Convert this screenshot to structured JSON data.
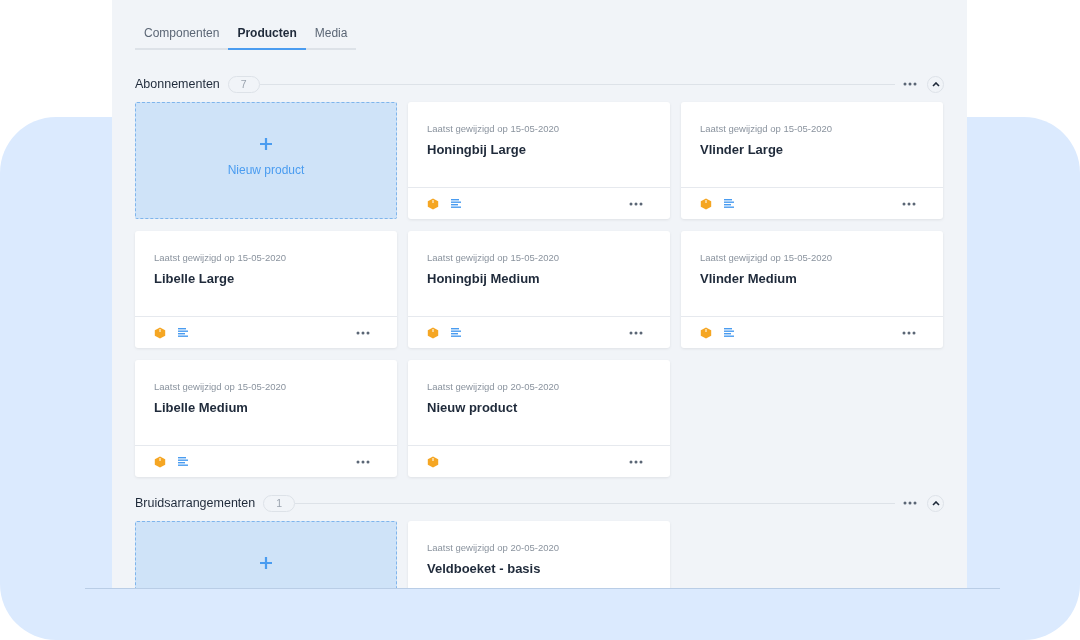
{
  "tabs": [
    {
      "label": "Componenten",
      "selected": false
    },
    {
      "label": "Producten",
      "selected": true
    },
    {
      "label": "Media",
      "selected": false
    }
  ],
  "sections": [
    {
      "title": "Abonnementen",
      "count": "7",
      "expanded": true,
      "cards": [
        {
          "kind": "new",
          "label": "Nieuw product"
        },
        {
          "kind": "product",
          "modified": "Laatst gewijzigd op 15-05-2020",
          "name": "Honingbij Large",
          "has_box": true,
          "has_notes": true
        },
        {
          "kind": "product",
          "modified": "Laatst gewijzigd op 15-05-2020",
          "name": "Vlinder Large",
          "has_box": true,
          "has_notes": true
        },
        {
          "kind": "product",
          "modified": "Laatst gewijzigd op 15-05-2020",
          "name": "Libelle Large",
          "has_box": true,
          "has_notes": true
        },
        {
          "kind": "product",
          "modified": "Laatst gewijzigd op 15-05-2020",
          "name": "Honingbij Medium",
          "has_box": true,
          "has_notes": true
        },
        {
          "kind": "product",
          "modified": "Laatst gewijzigd op 15-05-2020",
          "name": "Vlinder Medium",
          "has_box": true,
          "has_notes": true
        },
        {
          "kind": "product",
          "modified": "Laatst gewijzigd op 15-05-2020",
          "name": "Libelle Medium",
          "has_box": true,
          "has_notes": true
        },
        {
          "kind": "product",
          "modified": "Laatst gewijzigd op 20-05-2020",
          "name": "Nieuw product",
          "has_box": true,
          "has_notes": false
        }
      ]
    },
    {
      "title": "Bruidsarrangementen",
      "count": "1",
      "expanded": true,
      "cards": [
        {
          "kind": "new"
        },
        {
          "kind": "product",
          "modified": "Laatst gewijzigd op 20-05-2020",
          "name": "Veldboeket - basis"
        }
      ]
    }
  ]
}
